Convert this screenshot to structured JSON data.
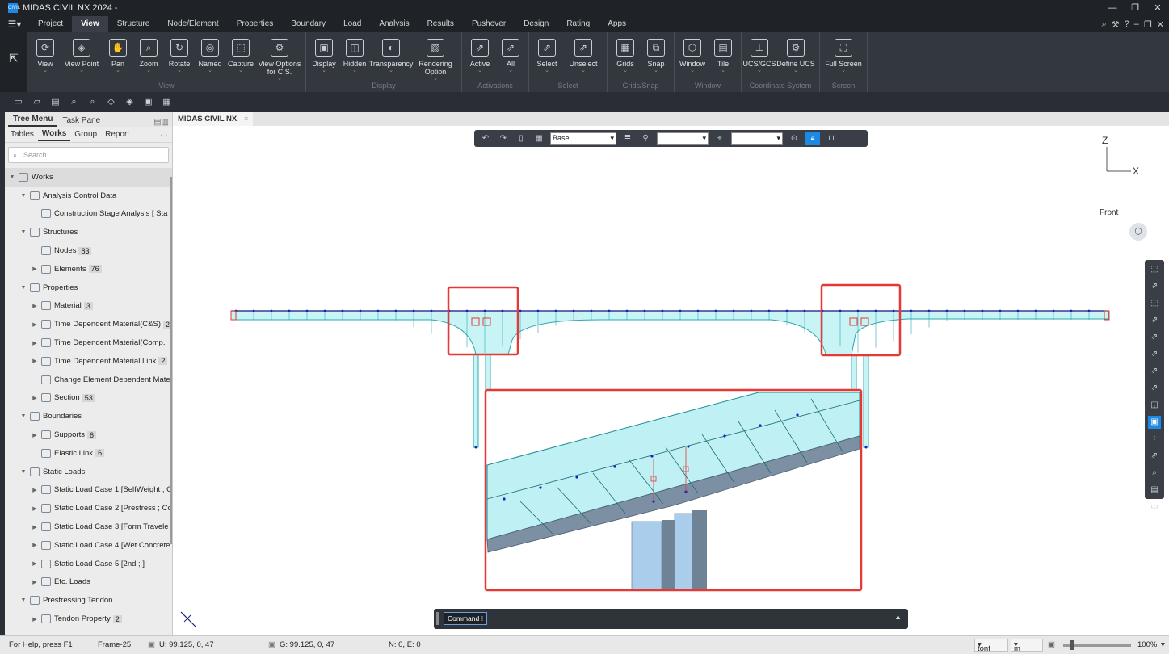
{
  "app": {
    "title": "MIDAS CIVIL NX 2024 -",
    "logo_text": "CIVIL"
  },
  "menu": {
    "tabs": [
      "Project",
      "View",
      "Structure",
      "Node/Element",
      "Properties",
      "Boundary",
      "Load",
      "Analysis",
      "Results",
      "Pushover",
      "Design",
      "Rating",
      "Apps"
    ],
    "active": "View"
  },
  "ribbon": {
    "groups": [
      {
        "title": "View",
        "buttons": [
          "View",
          "View Point",
          "Pan",
          "Zoom",
          "Rotate",
          "Named",
          "Capture",
          "View Options for C.S."
        ]
      },
      {
        "title": "Display",
        "buttons": [
          "Display",
          "Hidden",
          "Transparency",
          "Rendering Option"
        ]
      },
      {
        "title": "Activations",
        "buttons": [
          "Active",
          "All"
        ]
      },
      {
        "title": "Select",
        "buttons": [
          "Select",
          "Unselect"
        ]
      },
      {
        "title": "Grids/Snap",
        "buttons": [
          "Grids",
          "Snap"
        ]
      },
      {
        "title": "Window",
        "buttons": [
          "Window",
          "Tile"
        ]
      },
      {
        "title": "Coordinate System",
        "buttons": [
          "UCS/GCS",
          "Define UCS"
        ]
      },
      {
        "title": "Screen",
        "buttons": [
          "Full Screen"
        ]
      }
    ]
  },
  "left_panel": {
    "top_tabs": [
      "Tree Menu",
      "Task Pane"
    ],
    "sub_tabs": [
      "Tables",
      "Works",
      "Group",
      "Report"
    ],
    "active_sub_tab": "Works",
    "search_placeholder": "Search",
    "tree": [
      {
        "label": "Works",
        "level": 0,
        "expanded": true
      },
      {
        "label": "Analysis Control Data",
        "level": 1,
        "expanded": true
      },
      {
        "label": "Construction Stage Analysis [ Sta",
        "level": 2
      },
      {
        "label": "Structures",
        "level": 1,
        "expanded": true
      },
      {
        "label": "Nodes",
        "level": 2,
        "badge": "83"
      },
      {
        "label": "Elements",
        "level": 2,
        "badge": "76",
        "collapsed": true
      },
      {
        "label": "Properties",
        "level": 1,
        "expanded": true
      },
      {
        "label": "Material",
        "level": 2,
        "badge": "3",
        "collapsed": true
      },
      {
        "label": "Time Dependent Material(C&S)",
        "level": 2,
        "badge": "2",
        "collapsed": true
      },
      {
        "label": "Time Dependent Material(Comp.",
        "level": 2,
        "collapsed": true
      },
      {
        "label": "Time Dependent Material Link",
        "level": 2,
        "badge": "2",
        "collapsed": true
      },
      {
        "label": "Change Element Dependent Mate",
        "level": 2
      },
      {
        "label": "Section",
        "level": 2,
        "badge": "53",
        "collapsed": true
      },
      {
        "label": "Boundaries",
        "level": 1,
        "expanded": true
      },
      {
        "label": "Supports",
        "level": 2,
        "badge": "6",
        "collapsed": true
      },
      {
        "label": "Elastic Link",
        "level": 2,
        "badge": "6"
      },
      {
        "label": "Static Loads",
        "level": 1,
        "expanded": true
      },
      {
        "label": "Static Load Case 1 [SelfWeight ; C",
        "level": 2,
        "collapsed": true
      },
      {
        "label": "Static Load Case 2 [Prestress ; Co",
        "level": 2,
        "collapsed": true
      },
      {
        "label": "Static Load Case 3 [Form Travele",
        "level": 2,
        "collapsed": true
      },
      {
        "label": "Static Load Case 4 [Wet Concrete",
        "level": 2,
        "collapsed": true
      },
      {
        "label": "Static Load Case 5 [2nd ; ]",
        "level": 2,
        "collapsed": true
      },
      {
        "label": "Etc. Loads",
        "level": 2,
        "collapsed": true
      },
      {
        "label": "Prestressing Tendon",
        "level": 1,
        "expanded": true
      },
      {
        "label": "Tendon Property",
        "level": 2,
        "badge": "2",
        "collapsed": true
      }
    ]
  },
  "document": {
    "tab": "MIDAS CIVIL NX"
  },
  "view_toolbar": {
    "base_select": "Base"
  },
  "axis": {
    "z": "Z",
    "x": "X"
  },
  "view_label": "Front",
  "command": {
    "label": "Command"
  },
  "status": {
    "help": "For Help, press F1",
    "frame": "Frame-25",
    "u_coord": "U: 99.125, 0, 47",
    "g_coord": "G: 99.125, 0, 47",
    "ne": "N: 0, E: 0",
    "force_unit": "tonf",
    "length_unit": "m",
    "zoom": "100%"
  },
  "colors": {
    "accent": "#1e88e5",
    "highlight": "#e53935",
    "deck": "#c9f4f6",
    "deck_line": "#2aa7b0"
  }
}
